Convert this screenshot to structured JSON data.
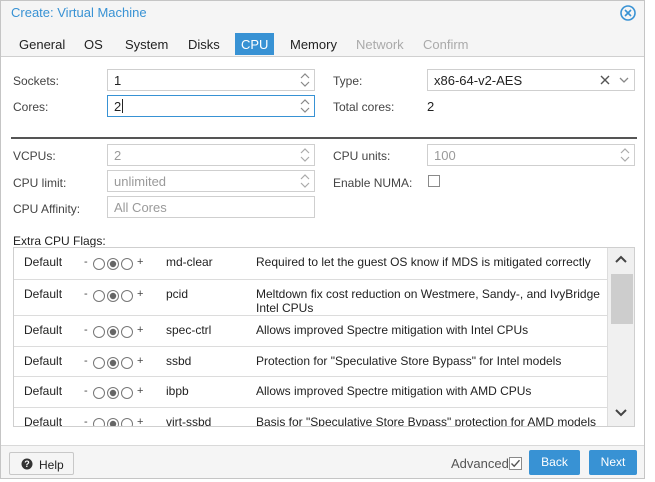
{
  "window": {
    "title": "Create: Virtual Machine"
  },
  "tabs": [
    {
      "label": "General",
      "state": "normal"
    },
    {
      "label": "OS",
      "state": "normal"
    },
    {
      "label": "System",
      "state": "normal"
    },
    {
      "label": "Disks",
      "state": "normal"
    },
    {
      "label": "CPU",
      "state": "active"
    },
    {
      "label": "Memory",
      "state": "normal"
    },
    {
      "label": "Network",
      "state": "disabled"
    },
    {
      "label": "Confirm",
      "state": "disabled"
    }
  ],
  "form": {
    "sockets_label": "Sockets:",
    "sockets_value": "1",
    "cores_label": "Cores:",
    "cores_value": "2",
    "type_label": "Type:",
    "type_value": "x86-64-v2-AES",
    "total_cores_label": "Total cores:",
    "total_cores_value": "2",
    "vcpus_label": "VCPUs:",
    "vcpus_value": "2",
    "cpu_units_label": "CPU units:",
    "cpu_units_value": "100",
    "cpu_limit_label": "CPU limit:",
    "cpu_limit_value": "unlimited",
    "enable_numa_label": "Enable NUMA:",
    "enable_numa_checked": false,
    "cpu_affinity_label": "CPU Affinity:",
    "cpu_affinity_placeholder": "All Cores"
  },
  "flags": {
    "label": "Extra CPU Flags:",
    "rows": [
      {
        "state": "Default",
        "minus": "-",
        "plus": "+",
        "name": "md-clear",
        "desc": "Required to let the guest OS know if MDS is mitigated correctly"
      },
      {
        "state": "Default",
        "minus": "-",
        "plus": "+",
        "name": "pcid",
        "desc": "Meltdown fix cost reduction on Westmere, Sandy-, and IvyBridge Intel CPUs"
      },
      {
        "state": "Default",
        "minus": "-",
        "plus": "+",
        "name": "spec-ctrl",
        "desc": "Allows improved Spectre mitigation with Intel CPUs"
      },
      {
        "state": "Default",
        "minus": "-",
        "plus": "+",
        "name": "ssbd",
        "desc": "Protection for \"Speculative Store Bypass\" for Intel models"
      },
      {
        "state": "Default",
        "minus": "-",
        "plus": "+",
        "name": "ibpb",
        "desc": "Allows improved Spectre mitigation with AMD CPUs"
      },
      {
        "state": "Default",
        "minus": "-",
        "plus": "+",
        "name": "virt-ssbd",
        "desc": "Basis for \"Speculative Store Bypass\" protection for AMD models"
      }
    ]
  },
  "footer": {
    "help_label": "Help",
    "advanced_label": "Advanced",
    "advanced_checked": true,
    "back_label": "Back",
    "next_label": "Next"
  },
  "colors": {
    "accent": "#3892d4",
    "title": "#3892d4"
  }
}
